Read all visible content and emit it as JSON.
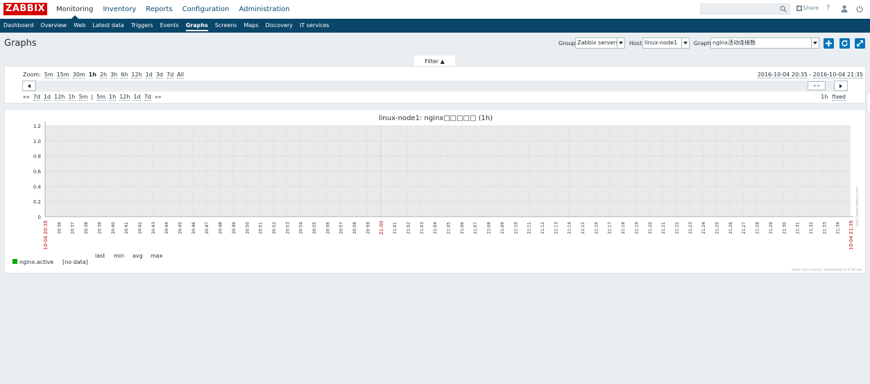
{
  "logo": "ZABBIX",
  "topnav": [
    "Monitoring",
    "Inventory",
    "Reports",
    "Configuration",
    "Administration"
  ],
  "topnav_active": 0,
  "header_tools": {
    "share": "Share",
    "help": "?"
  },
  "subnav": [
    "Dashboard",
    "Overview",
    "Web",
    "Latest data",
    "Triggers",
    "Events",
    "Graphs",
    "Screens",
    "Maps",
    "Discovery",
    "IT services"
  ],
  "subnav_active": 6,
  "page_title": "Graphs",
  "controls": {
    "group_label": "Group",
    "group_value": "Zabbix servers",
    "host_label": "Host",
    "host_value": "linux-node1",
    "graph_label": "Graph",
    "graph_value": "nginx活动连接数"
  },
  "filter": {
    "tab_label": "Filter ▲",
    "zoom_label": "Zoom:",
    "zoom_options": [
      "5m",
      "15m",
      "30m",
      "1h",
      "2h",
      "3h",
      "6h",
      "12h",
      "1d",
      "3d",
      "7d",
      "All"
    ],
    "zoom_active": "1h",
    "range_start": "2016-10-04 20:35",
    "range_sep": " - ",
    "range_end": "2016-10-04 21:35",
    "nav_back_arrow": "«« ",
    "nav_back": [
      "7d",
      "1d",
      "12h",
      "1h",
      "5m"
    ],
    "nav_sep": "|",
    "nav_fwd": [
      "5m",
      "1h",
      "12h",
      "1d",
      "7d"
    ],
    "nav_fwd_arrow": "»»",
    "period": "1h",
    "fixed": "fixed"
  },
  "graph": {
    "title": "linux-node1: nginx□□□□□ (1h)",
    "legend_headers": [
      "last",
      "min",
      "avg",
      "max"
    ],
    "legend_item": "nginx.active",
    "legend_value": "[no data]",
    "footer": "Data from history. Generated in 0.04 sec",
    "watermark": "http://www.zabbix.com",
    "series_color": "#00aa00"
  },
  "chart_data": {
    "type": "line",
    "title": "linux-node1: nginx□□□□□ (1h)",
    "ylim": [
      0,
      1.2
    ],
    "y_ticks": [
      "1.2",
      "1.0",
      "0.8",
      "0.6",
      "0.4",
      "0.2",
      "0"
    ],
    "x_start_label": "10-04 20:35",
    "x_end_label": "10-04 21:35",
    "x_mid_label": "21:00",
    "x_ticks": [
      "20:36",
      "20:37",
      "20:38",
      "20:39",
      "20:40",
      "20:41",
      "20:42",
      "20:43",
      "20:44",
      "20:45",
      "20:46",
      "20:47",
      "20:48",
      "20:49",
      "20:50",
      "20:51",
      "20:52",
      "20:53",
      "20:54",
      "20:55",
      "20:56",
      "20:57",
      "20:58",
      "20:59",
      "21:01",
      "21:02",
      "21:03",
      "21:04",
      "21:05",
      "21:06",
      "21:07",
      "21:08",
      "21:09",
      "21:10",
      "21:11",
      "21:12",
      "21:13",
      "21:14",
      "21:15",
      "21:16",
      "21:17",
      "21:18",
      "21:19",
      "21:20",
      "21:21",
      "21:22",
      "21:23",
      "21:24",
      "21:25",
      "21:26",
      "21:27",
      "21:28",
      "21:29",
      "21:30",
      "21:31",
      "21:32",
      "21:33",
      "21:34",
      "21:35"
    ],
    "series": [
      {
        "name": "nginx.active",
        "values": []
      }
    ]
  }
}
